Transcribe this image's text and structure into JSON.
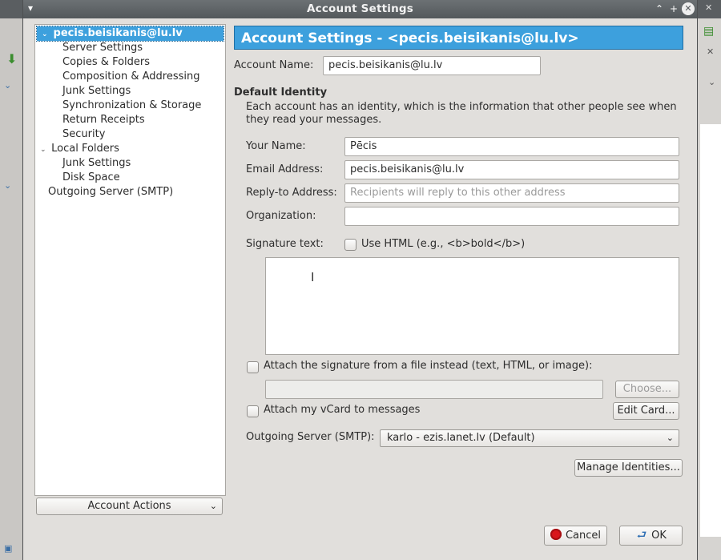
{
  "window": {
    "title": "Account Settings"
  },
  "tree": {
    "items": [
      {
        "label": "pecis.beisikanis@lu.lv",
        "level": 0,
        "expanded": true,
        "selected": true
      },
      {
        "label": "Server Settings",
        "level": 1
      },
      {
        "label": "Copies & Folders",
        "level": 1
      },
      {
        "label": "Composition & Addressing",
        "level": 1
      },
      {
        "label": "Junk Settings",
        "level": 1
      },
      {
        "label": "Synchronization & Storage",
        "level": 1
      },
      {
        "label": "Return Receipts",
        "level": 1
      },
      {
        "label": "Security",
        "level": 1
      },
      {
        "label": "Local Folders",
        "level": 0,
        "expanded": true
      },
      {
        "label": "Junk Settings",
        "level": 1
      },
      {
        "label": "Disk Space",
        "level": 1
      },
      {
        "label": "Outgoing Server (SMTP)",
        "level": 0
      }
    ]
  },
  "account_actions": {
    "label": "Account Actions"
  },
  "main": {
    "header": "Account Settings - <pecis.beisikanis@lu.lv>",
    "account_name_label": "Account Name:",
    "account_name_value": "pecis.beisikanis@lu.lv",
    "identity_title": "Default Identity",
    "identity_desc_1": "Each account has an identity, which is the information that other people see when",
    "identity_desc_2": "they read your messages.",
    "your_name_label": "Your Name:",
    "your_name_value": "Pēcis",
    "email_label": "Email Address:",
    "email_value": "pecis.beisikanis@lu.lv",
    "reply_to_label": "Reply-to Address:",
    "reply_to_placeholder": "Recipients will reply to this other address",
    "org_label": "Organization:",
    "org_value": "",
    "signature_label": "Signature text:",
    "use_html_label": "Use HTML (e.g., <b>bold</b>)",
    "use_html_checked": false,
    "signature_text": "",
    "attach_sig_label": "Attach the signature from a file instead (text, HTML, or image):",
    "attach_sig_checked": false,
    "attach_sig_path": "",
    "choose_label": "Choose...",
    "attach_vcard_label": "Attach my vCard to messages",
    "attach_vcard_checked": false,
    "edit_card_label": "Edit Card...",
    "smtp_label": "Outgoing Server (SMTP):",
    "smtp_value": "karlo - ezis.lanet.lv (Default)",
    "manage_identities_label": "Manage Identities..."
  },
  "footer": {
    "cancel_label": "Cancel",
    "ok_label": "OK"
  }
}
